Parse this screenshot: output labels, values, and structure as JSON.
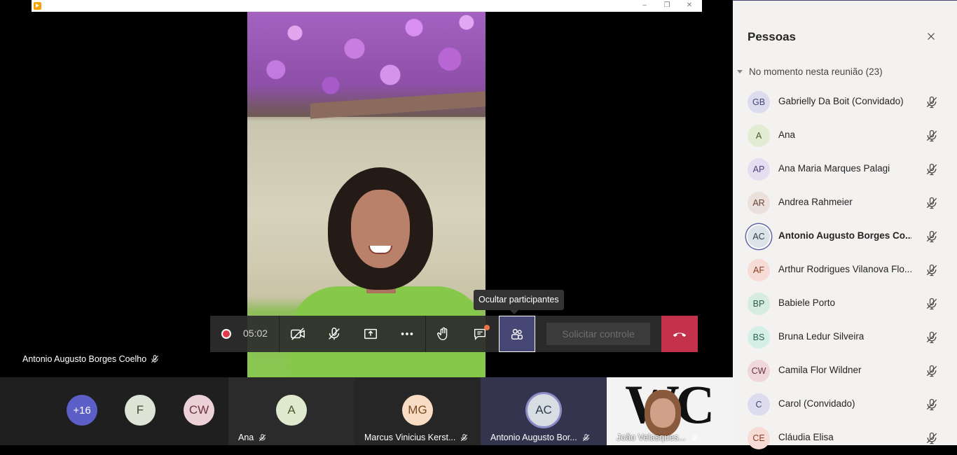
{
  "window": {
    "minimize_glyph": "–",
    "restore_glyph": "❐",
    "close_glyph": "✕"
  },
  "stage": {
    "main_participant_label": "Antonio Augusto Borges Coelho",
    "tooltip": "Ocultar participantes"
  },
  "toolbar": {
    "timer": "05:02",
    "request_control_label": "Solicitar controle",
    "icons": [
      "record-icon",
      "camera-off-icon",
      "mic-off-icon",
      "share-screen-icon",
      "more-icon",
      "raise-hand-icon",
      "chat-icon",
      "participants-icon",
      "hang-up-icon"
    ]
  },
  "strip": {
    "overflow_count": "+16",
    "tiles": [
      {
        "initials": "F",
        "color": "#dde3d5",
        "text_color": "#3d4b2f"
      },
      {
        "initials": "CW",
        "color": "#ecd2d8",
        "text_color": "#6b3444"
      }
    ],
    "named_tiles": [
      {
        "initials": "A",
        "name": "Ana",
        "color": "#dfe9cd",
        "text_color": "#4a5a2a"
      },
      {
        "initials": "MG",
        "name": "Marcus Vinicius Kerst...",
        "color": "#f8dcc4",
        "text_color": "#7a4a1c"
      },
      {
        "initials": "AC",
        "name": "Antonio Augusto Bor...",
        "color": "#d6dde3",
        "text_color": "#2d3e4e"
      },
      {
        "name": "João Velasques..."
      }
    ]
  },
  "panel": {
    "title": "Pessoas",
    "section": "No momento nesta reunião (23)",
    "people": [
      {
        "initials": "GB",
        "name": "Gabrielly Da Boit (Convidado)",
        "bg": "#dcdcee",
        "fg": "#464775",
        "bold": false
      },
      {
        "initials": "A",
        "name": "Ana",
        "bg": "#e2ecd2",
        "fg": "#4a5a2a",
        "bold": false
      },
      {
        "initials": "AP",
        "name": "Ana Maria Marques Palagi",
        "bg": "#e3dff0",
        "fg": "#4e3d7a",
        "bold": false
      },
      {
        "initials": "AR",
        "name": "Andrea Rahmeier",
        "bg": "#ece0dc",
        "fg": "#6b4238",
        "bold": false
      },
      {
        "initials": "AC",
        "name": "Antonio Augusto Borges Co...",
        "bg": "#dbe3e8",
        "fg": "#2d3e4e",
        "bold": true
      },
      {
        "initials": "AF",
        "name": "Arthur Rodrigues Vilanova Flo...",
        "bg": "#f6dcd4",
        "fg": "#8a3d26",
        "bold": false
      },
      {
        "initials": "BP",
        "name": "Babiele Porto",
        "bg": "#d6ece2",
        "fg": "#2d5e47",
        "bold": false
      },
      {
        "initials": "BS",
        "name": "Bruna Ledur Silveira",
        "bg": "#d6efe6",
        "fg": "#2a6450",
        "bold": false
      },
      {
        "initials": "CW",
        "name": "Camila Flor Wildner",
        "bg": "#efd7dc",
        "fg": "#6b3444",
        "bold": false
      },
      {
        "initials": "C",
        "name": "Carol (Convidado)",
        "bg": "#dcdcee",
        "fg": "#464775",
        "bold": false
      },
      {
        "initials": "CE",
        "name": "Cláudia Elisa",
        "bg": "#f6dcd4",
        "fg": "#8a3d26",
        "bold": false
      }
    ]
  }
}
